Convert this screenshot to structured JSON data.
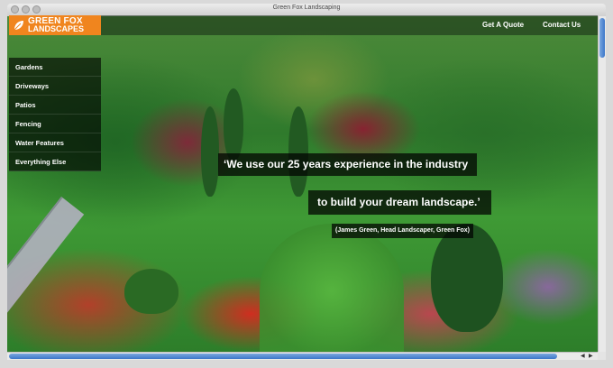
{
  "window": {
    "title": "Green Fox Landscaping"
  },
  "brand": {
    "line1": "GREEN FOX",
    "line2": "LANDSCAPES",
    "orange": "#f0851e"
  },
  "topnav": {
    "quote_label": "Get A Quote",
    "contact_label": "Contact Us"
  },
  "sidenav": {
    "items": [
      "Gardens",
      "Driveways",
      "Patios",
      "Fencing",
      "Water Features",
      "Everything Else"
    ]
  },
  "hero": {
    "quote_line1": "‘We use our 25 years experience in the industry",
    "quote_line2": "to build your dream landscape.’",
    "attribution": "(James Green, Head Landscaper, Green Fox)"
  },
  "scrollbar": {
    "left_arrow": "◀",
    "right_arrow": "▶"
  }
}
